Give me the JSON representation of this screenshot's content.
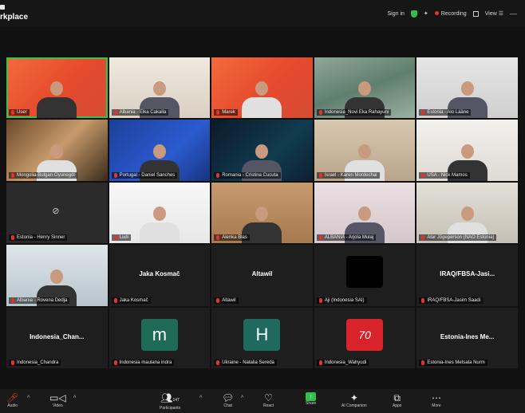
{
  "topbar": {
    "app_title": "rkplace",
    "sign_in": "Sign in",
    "recording": "Recording",
    "view": "View"
  },
  "colors": {
    "accent_green": "#37c24a",
    "muted_red": "#e5322d",
    "background": "#111111"
  },
  "tiles": [
    {
      "name": "User",
      "kind": "video",
      "bg": "bg-orange",
      "active": true
    },
    {
      "name": "Albania - Elka Cakalla",
      "kind": "video",
      "bg": "bg-room"
    },
    {
      "name": "Marek",
      "kind": "video",
      "bg": "bg-orange"
    },
    {
      "name": "Indonesia_Novi Eka Rahayuni",
      "kind": "video",
      "bg": "bg-window"
    },
    {
      "name": "Estonia - Alo Lääne",
      "kind": "video",
      "bg": "bg-office"
    },
    {
      "name": "Mongolia-Bulgan-Oyunegöl",
      "kind": "video",
      "bg": "bg-art"
    },
    {
      "name": "Portugal - Daniel Sanches",
      "kind": "video",
      "bg": "bg-blue"
    },
    {
      "name": "Romania - Cristina Cucuta",
      "kind": "video",
      "bg": "bg-darkblue"
    },
    {
      "name": "Israel - Karen Mordechai",
      "kind": "video",
      "bg": "bg-warm"
    },
    {
      "name": "USA - Nick Mamos",
      "kind": "video",
      "bg": "bg-light"
    },
    {
      "name": "Estonia - Henry Sinner",
      "kind": "camoff"
    },
    {
      "name": "Ludi",
      "kind": "video",
      "bg": "bg-white"
    },
    {
      "name": "Alenka Blas",
      "kind": "video",
      "bg": "bg-wood"
    },
    {
      "name": "ALBANIA - Arjola Mulaj",
      "kind": "video",
      "bg": "bg-pink"
    },
    {
      "name": "Alar Jõgeperson (NAO Estonia)",
      "kind": "video",
      "bg": "bg-shelf"
    },
    {
      "name": "Albania - Rovena Dedja",
      "kind": "video",
      "bg": "bg-window2"
    },
    {
      "name": "Jaka Kosmač",
      "kind": "name",
      "display": "Jaka Kosmač"
    },
    {
      "name": "Altawil",
      "kind": "name",
      "display": "Altawil"
    },
    {
      "name": "Aji (Indonesia SAI)",
      "kind": "black"
    },
    {
      "name": "IRAQ/FBSA-Jasim Saadi",
      "kind": "name",
      "display": "IRAQ/FBSA-Jasi..."
    },
    {
      "name": "Indonesia_Chandra",
      "kind": "name",
      "display": "Indonesia_Chan..."
    },
    {
      "name": "Indonesia maulana indra",
      "kind": "avatar",
      "letter": "m",
      "color": "#1d6b57"
    },
    {
      "name": "Ukraine - Natalia Sereda",
      "kind": "avatar",
      "letter": "H",
      "color": "#1e6a5e"
    },
    {
      "name": "Indonesia_Wahyudi",
      "kind": "logo",
      "letter": "70"
    },
    {
      "name": "Estonia-Ines Metsala Nurm",
      "kind": "name",
      "display": "Estonia-Ines Me..."
    }
  ],
  "toolbar": {
    "audio": "Audio",
    "video": "Video",
    "participants": "Participants",
    "participants_count": "147",
    "chat": "Chat",
    "react": "React",
    "share": "Share",
    "ai": "AI Companion",
    "apps": "Apps",
    "more": "More"
  }
}
